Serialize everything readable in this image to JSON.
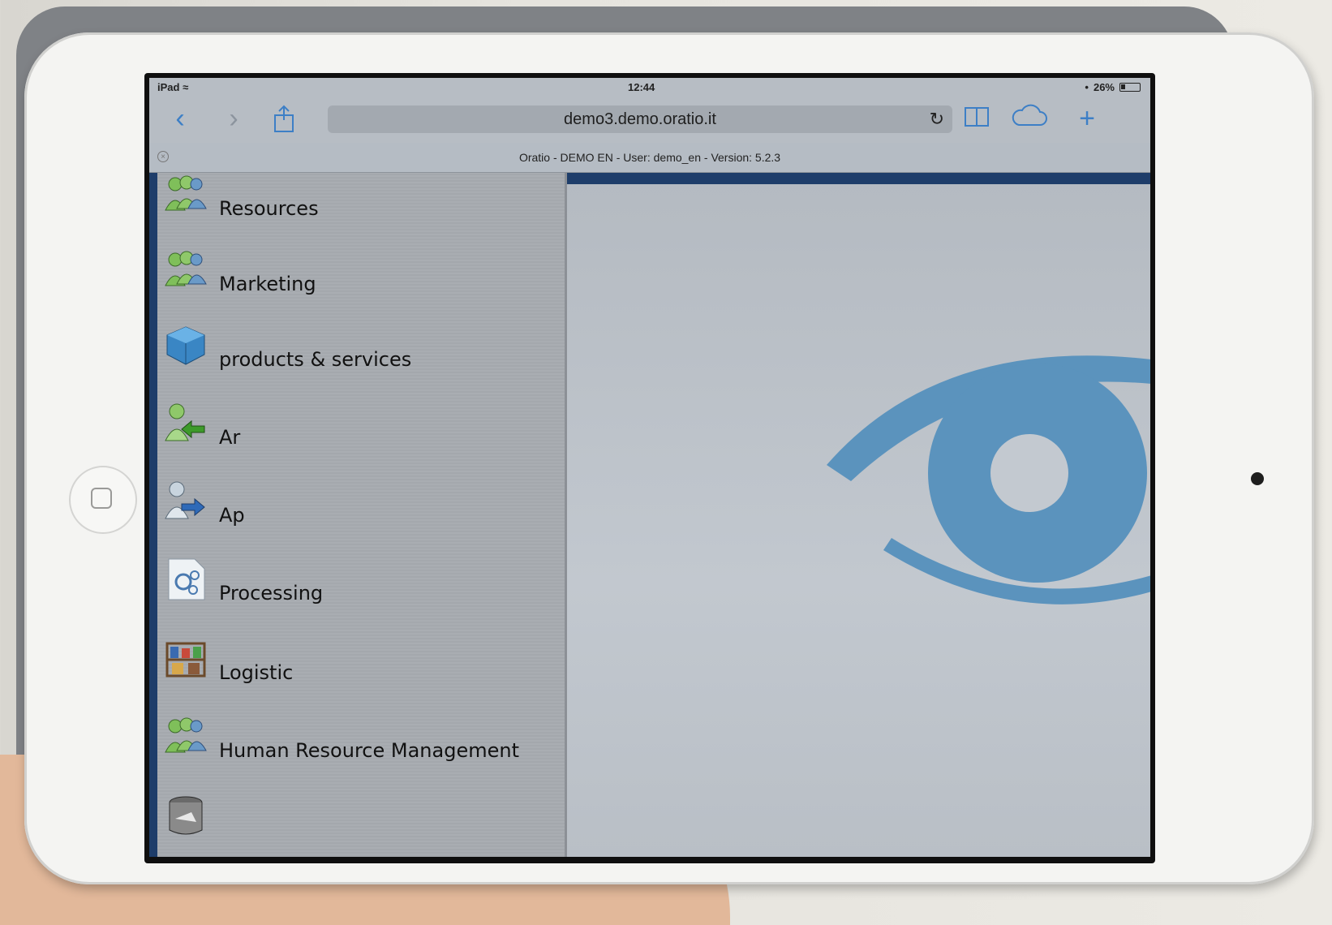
{
  "status_bar": {
    "device": "iPad",
    "time": "12:44",
    "battery": "26%",
    "battery_level": 0.26
  },
  "browser": {
    "url": "demo3.demo.oratio.it",
    "icons": {
      "back": "back-chevron-icon",
      "forward": "forward-chevron-icon",
      "share": "share-icon",
      "reload": "reload-icon",
      "bookmarks": "book-icon",
      "cloud": "cloud-icon",
      "new_tab": "plus-icon"
    }
  },
  "banner": {
    "text": "Oratio - DEMO EN - User: demo_en - Version: 5.2.3"
  },
  "menu": {
    "items": [
      {
        "label": "Resources",
        "icon": "people-icon"
      },
      {
        "label": "Marketing",
        "icon": "people-icon"
      },
      {
        "label": "products & services",
        "icon": "cube-icon"
      },
      {
        "label": "Ar",
        "icon": "person-arrow-in-icon"
      },
      {
        "label": "Ap",
        "icon": "person-arrow-out-icon"
      },
      {
        "label": "Processing",
        "icon": "gears-document-icon"
      },
      {
        "label": "Logistic",
        "icon": "shelves-icon"
      },
      {
        "label": "Human Resource Management",
        "icon": "people-icon"
      },
      {
        "label": "",
        "icon": "database-icon"
      }
    ]
  },
  "colors": {
    "accent": "#3d7fc6",
    "nav_dark": "#1e3d6a",
    "eye_logo": "#5b93bd"
  }
}
